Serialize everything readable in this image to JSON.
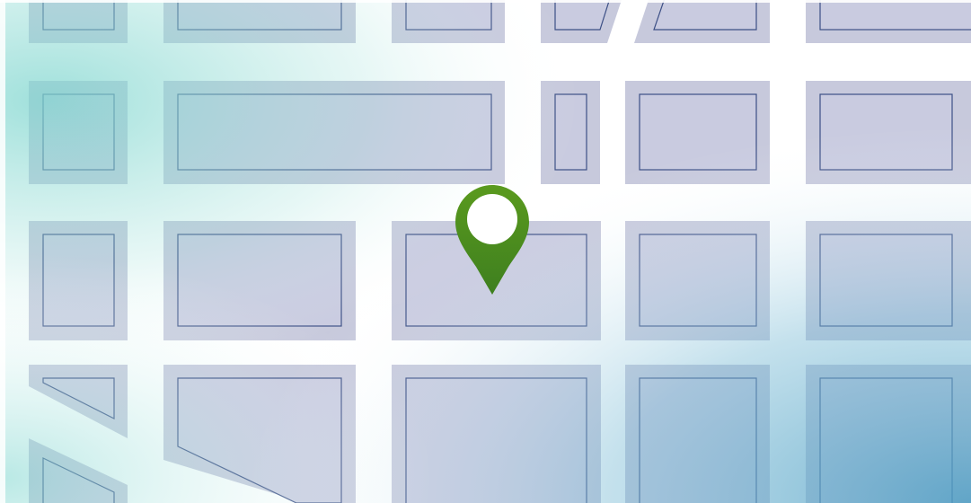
{
  "map": {
    "style": "stylized-city-grid",
    "colors": {
      "road": "#ffffff",
      "block": "#c7c9dc",
      "block_outline": "#3c4f85",
      "glow_teal": "#7fd6cf",
      "glow_blue": "#5aa8c8"
    },
    "marker": {
      "icon": "location-pin-icon",
      "color_top": "#5a9a1e",
      "color_bottom": "#3e7f1f",
      "hole_color": "#ffffff"
    }
  }
}
